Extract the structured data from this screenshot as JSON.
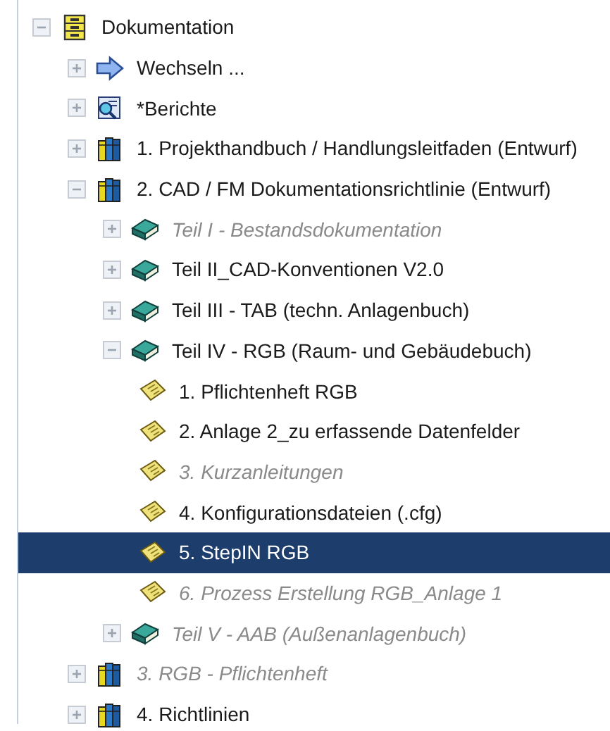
{
  "tree": [
    {
      "label": "Dokumentation",
      "kind": "drawers",
      "expanded": true,
      "disabled": false,
      "selected": false,
      "children": [
        {
          "label": "Wechseln ...",
          "kind": "arrow",
          "expanded": false,
          "disabled": false,
          "selected": false
        },
        {
          "label": "*Berichte",
          "kind": "report",
          "expanded": false,
          "disabled": false,
          "selected": false
        },
        {
          "label": "1. Projekthandbuch / Handlungsleitfaden (Entwurf)",
          "kind": "books",
          "expanded": false,
          "disabled": false,
          "selected": false
        },
        {
          "label": "2. CAD / FM Dokumentationsrichtlinie (Entwurf)",
          "kind": "books",
          "expanded": true,
          "disabled": false,
          "selected": false,
          "children": [
            {
              "label": "Teil I - Bestandsdokumentation",
              "kind": "book",
              "expanded": false,
              "disabled": true,
              "selected": false
            },
            {
              "label": "Teil II_CAD-Konventionen V2.0",
              "kind": "book",
              "expanded": false,
              "disabled": false,
              "selected": false
            },
            {
              "label": "Teil III - TAB (techn. Anlagenbuch)",
              "kind": "book",
              "expanded": false,
              "disabled": false,
              "selected": false
            },
            {
              "label": "Teil IV - RGB (Raum- und Gebäudebuch)",
              "kind": "book",
              "expanded": true,
              "disabled": false,
              "selected": false,
              "children": [
                {
                  "label": "1. Pflichtenheft RGB",
                  "kind": "note",
                  "disabled": false,
                  "selected": false
                },
                {
                  "label": "2. Anlage 2_zu erfassende Datenfelder",
                  "kind": "note",
                  "disabled": false,
                  "selected": false
                },
                {
                  "label": "3. Kurzanleitungen",
                  "kind": "note",
                  "disabled": true,
                  "selected": false
                },
                {
                  "label": "4. Konfigurationsdateien (.cfg)",
                  "kind": "note",
                  "disabled": false,
                  "selected": false
                },
                {
                  "label": "5. StepIN RGB",
                  "kind": "note",
                  "disabled": false,
                  "selected": true
                },
                {
                  "label": "6. Prozess Erstellung RGB_Anlage 1",
                  "kind": "note",
                  "disabled": true,
                  "selected": false
                }
              ]
            },
            {
              "label": "Teil V - AAB (Außenanlagenbuch)",
              "kind": "book",
              "expanded": false,
              "disabled": true,
              "selected": false
            }
          ]
        },
        {
          "label": "3. RGB - Pflichtenheft",
          "kind": "books",
          "expanded": false,
          "disabled": true,
          "selected": false
        },
        {
          "label": "4. Richtlinien",
          "kind": "books",
          "expanded": false,
          "disabled": false,
          "selected": false
        }
      ]
    }
  ]
}
